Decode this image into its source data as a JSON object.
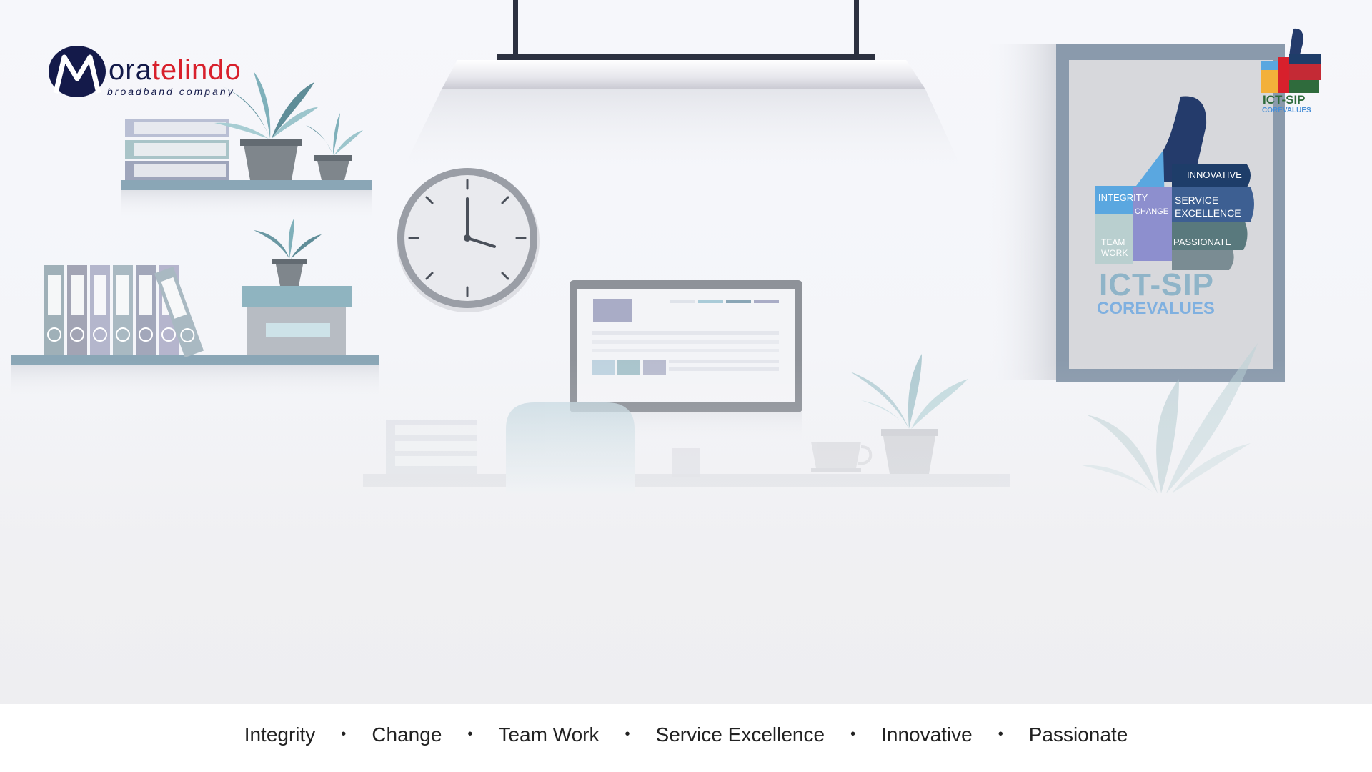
{
  "logo": {
    "brand_dark": "M",
    "brand_mid": "ora",
    "brand_red": "telindo",
    "tagline": "broadband company"
  },
  "poster": {
    "pieces": {
      "integrity": "INTEGRITY",
      "change": "CHANGE",
      "innovative": "INNOVATIVE",
      "service_1": "SERVICE",
      "service_2": "EXCELLENCE",
      "team_1": "TEAM",
      "team_2": "WORK",
      "passionate": "PASSIONATE"
    },
    "title": "ICT-SIP",
    "subtitle": "COREVALUES"
  },
  "corner_badge": {
    "title": "ICT-SIP",
    "subtitle": "COREVALUES"
  },
  "footer": {
    "values": [
      "Integrity",
      "Change",
      "Team Work",
      "Service Excellence",
      "Innovative",
      "Passionate"
    ]
  },
  "colors": {
    "navy": "#141a4a",
    "brand_red": "#d8202c",
    "poster_frame": "#8a9aac",
    "teal": "#7fb0ba"
  }
}
